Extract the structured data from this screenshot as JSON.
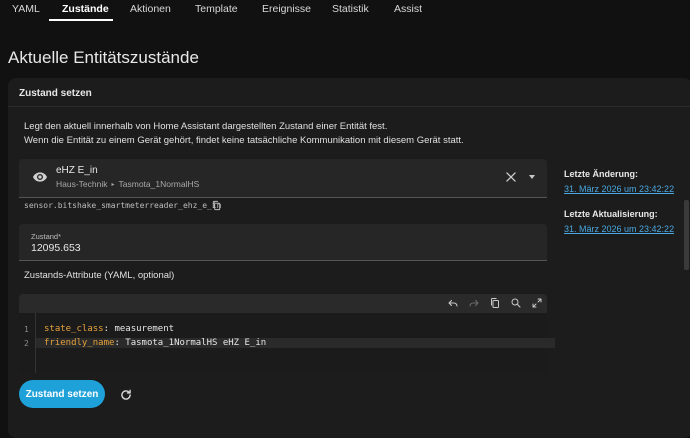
{
  "tabs": [
    {
      "label": "YAML"
    },
    {
      "label": "Zustände"
    },
    {
      "label": "Aktionen"
    },
    {
      "label": "Template"
    },
    {
      "label": "Ereignisse"
    },
    {
      "label": "Statistik"
    },
    {
      "label": "Assist"
    }
  ],
  "active_tab": "Zustände",
  "page": {
    "title": "Aktuelle Entitätszustände"
  },
  "card": {
    "title": "Zustand setzen",
    "description_line1": "Legt den aktuell innerhalb von Home Assistant dargestellten Zustand einer Entität fest.",
    "description_line2": "Wenn die Entität zu einem Gerät gehört, findet keine tatsächliche Kommunikation mit diesem Gerät statt."
  },
  "entity": {
    "name": "eHZ E_in",
    "area": "Haus-Technik",
    "device": "Tasmota_1NormalHS",
    "entity_id": "sensor.bitshake_smartmeterreader_ehz_e_in"
  },
  "state_field": {
    "label": "Zustand*",
    "value": "12095.653"
  },
  "attributes": {
    "label": "Zustands-Attribute (YAML, optional)",
    "lines": [
      {
        "num": "1",
        "key": "state_class",
        "value": "measurement"
      },
      {
        "num": "2",
        "key": "friendly_name",
        "value": "Tasmota_1NormalHS eHZ E_in"
      }
    ]
  },
  "actions": {
    "submit_label": "Zustand setzen"
  },
  "sidebar": {
    "last_changed_label": "Letzte Änderung:",
    "last_changed_value": "31. März 2026 um 23:42:22",
    "last_updated_label": "Letzte Aktualisierung:",
    "last_updated_value": "31. März 2026 um 23:42:22"
  },
  "colors": {
    "accent": "#1ea0d8",
    "link": "#4aa8e0",
    "yaml_key": "#e6a23c",
    "background": "#111111",
    "card": "#1c1c1c"
  },
  "icons": [
    "eye-icon",
    "close-icon",
    "chevron-down-icon",
    "copy-icon",
    "undo-icon",
    "redo-icon",
    "copy-code-icon",
    "search-replace-icon",
    "fullscreen-icon",
    "refresh-icon"
  ]
}
